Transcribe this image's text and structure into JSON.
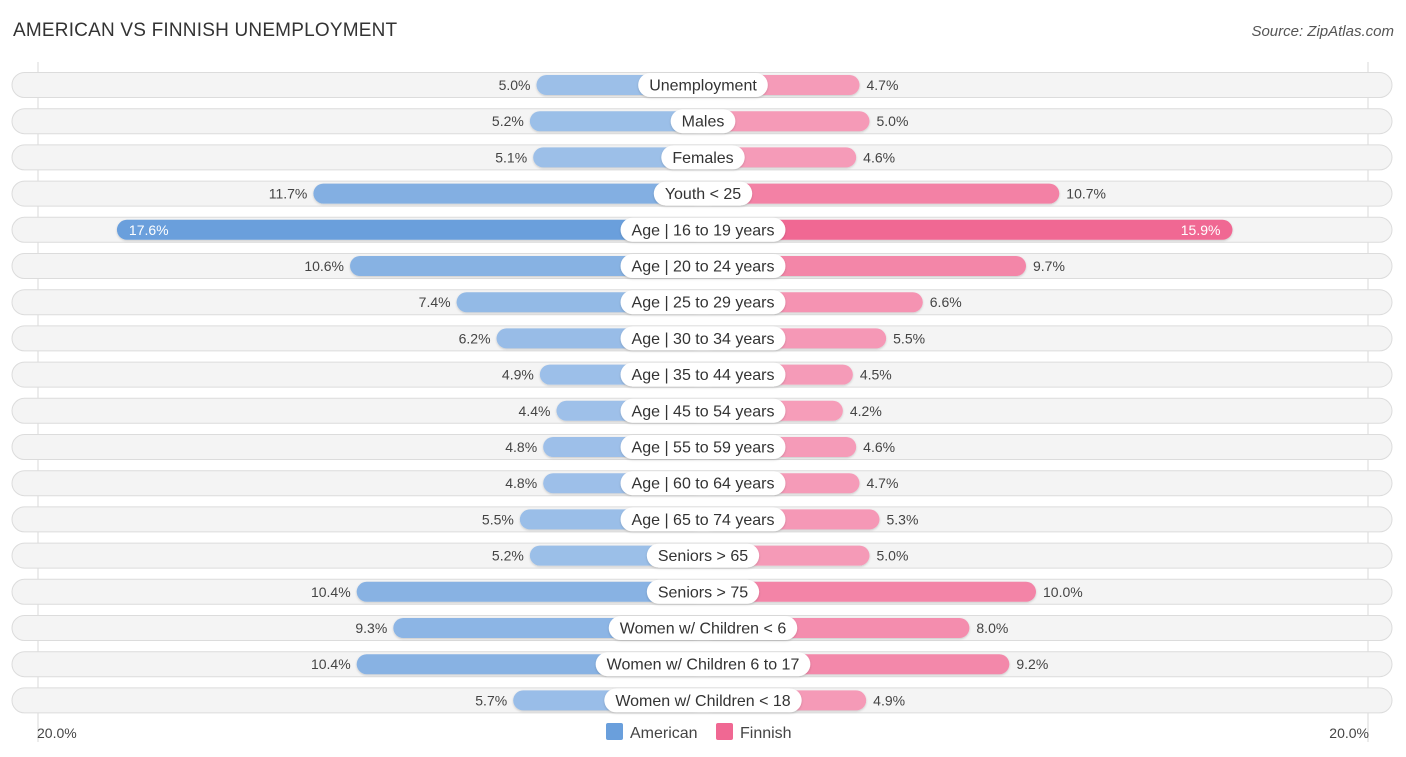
{
  "header": {
    "title": "AMERICAN VS FINNISH UNEMPLOYMENT",
    "source": "Source: ZipAtlas.com"
  },
  "chart_data": {
    "type": "bar",
    "orientation": "horizontal-diverging",
    "title": "AMERICAN VS FINNISH UNEMPLOYMENT",
    "categories": [
      "Unemployment",
      "Males",
      "Females",
      "Youth < 25",
      "Age | 16 to 19 years",
      "Age | 20 to 24 years",
      "Age | 25 to 29 years",
      "Age | 30 to 34 years",
      "Age | 35 to 44 years",
      "Age | 45 to 54 years",
      "Age | 55 to 59 years",
      "Age | 60 to 64 years",
      "Age | 65 to 74 years",
      "Seniors > 65",
      "Seniors > 75",
      "Women w/ Children < 6",
      "Women w/ Children 6 to 17",
      "Women w/ Children < 18"
    ],
    "series": [
      {
        "name": "American",
        "side": "left",
        "color": "#6a9fdc",
        "values": [
          5.0,
          5.2,
          5.1,
          11.7,
          17.6,
          10.6,
          7.4,
          6.2,
          4.9,
          4.4,
          4.8,
          4.8,
          5.5,
          5.2,
          10.4,
          9.3,
          10.4,
          5.7
        ],
        "labels": [
          "5.0%",
          "5.2%",
          "5.1%",
          "11.7%",
          "17.6%",
          "10.6%",
          "7.4%",
          "6.2%",
          "4.9%",
          "4.4%",
          "4.8%",
          "4.8%",
          "5.5%",
          "5.2%",
          "10.4%",
          "9.3%",
          "10.4%",
          "5.7%"
        ]
      },
      {
        "name": "Finnish",
        "side": "right",
        "color": "#f06893",
        "values": [
          4.7,
          5.0,
          4.6,
          10.7,
          15.9,
          9.7,
          6.6,
          5.5,
          4.5,
          4.2,
          4.6,
          4.7,
          5.3,
          5.0,
          10.0,
          8.0,
          9.2,
          4.9
        ],
        "labels": [
          "4.7%",
          "5.0%",
          "4.6%",
          "10.7%",
          "15.9%",
          "9.7%",
          "6.6%",
          "5.5%",
          "4.5%",
          "4.2%",
          "4.6%",
          "4.7%",
          "5.3%",
          "5.0%",
          "10.0%",
          "8.0%",
          "9.2%",
          "4.9%"
        ]
      }
    ],
    "xlim": [
      0,
      20.0
    ],
    "axis_labels": {
      "left": "20.0%",
      "right": "20.0%"
    },
    "legend": {
      "position": "bottom-center",
      "entries": [
        "American",
        "Finnish"
      ]
    },
    "units": "%",
    "grid": false
  }
}
